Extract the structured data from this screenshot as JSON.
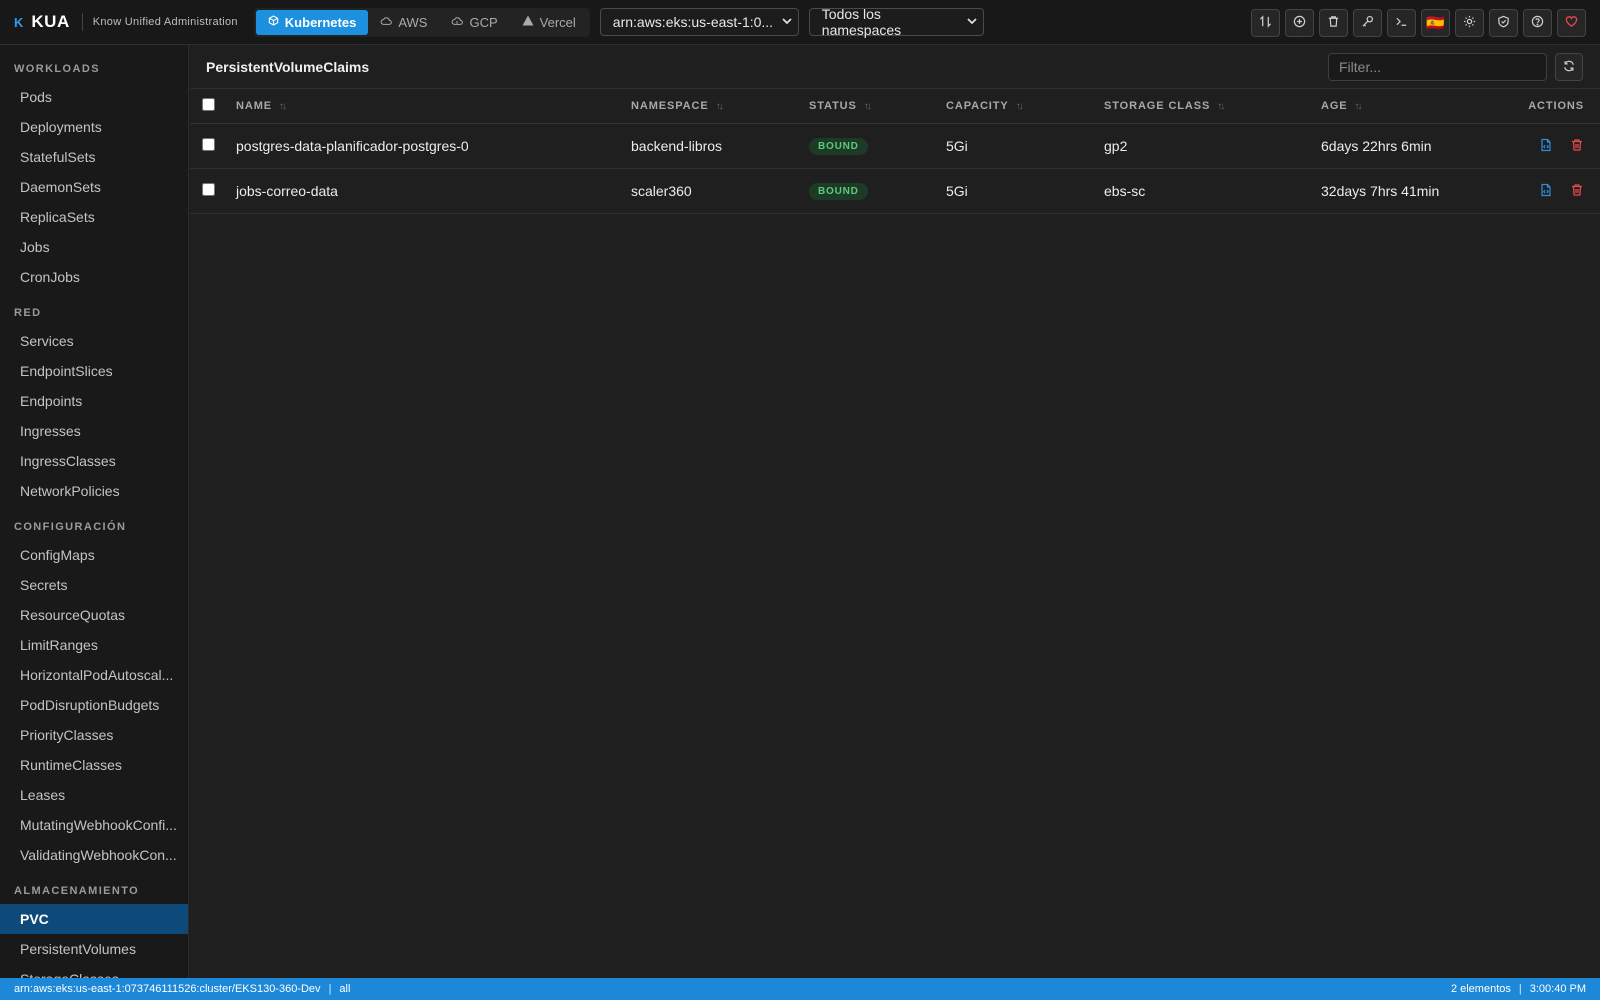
{
  "app": {
    "logo_mark": "K",
    "name": "KUA",
    "subtitle": "Know Unified Administration"
  },
  "providers": [
    {
      "label": "Kubernetes",
      "icon": "cube-icon",
      "active": true
    },
    {
      "label": "AWS",
      "icon": "cloud-icon",
      "active": false
    },
    {
      "label": "GCP",
      "icon": "cloud-icon",
      "active": false
    },
    {
      "label": "Vercel",
      "icon": "triangle-icon",
      "active": false
    }
  ],
  "cluster_select": {
    "value": "arn:aws:eks:us-east-1:0..."
  },
  "namespace_select": {
    "value": "Todos los namespaces"
  },
  "toolbar": {
    "icons": [
      "port-forward-icon",
      "add-circle-icon",
      "trash-icon",
      "key-icon",
      "terminal-icon",
      "spain-flag-icon",
      "sun-icon",
      "shield-icon",
      "help-icon",
      "heart-icon"
    ],
    "flag_glyph": "🇪🇸"
  },
  "sidebar": {
    "sections": [
      {
        "title": "WORKLOADS",
        "items": [
          "Pods",
          "Deployments",
          "StatefulSets",
          "DaemonSets",
          "ReplicaSets",
          "Jobs",
          "CronJobs"
        ]
      },
      {
        "title": "RED",
        "items": [
          "Services",
          "EndpointSlices",
          "Endpoints",
          "Ingresses",
          "IngressClasses",
          "NetworkPolicies"
        ]
      },
      {
        "title": "CONFIGURACIÓN",
        "items": [
          "ConfigMaps",
          "Secrets",
          "ResourceQuotas",
          "LimitRanges",
          "HorizontalPodAutoscal...",
          "PodDisruptionBudgets",
          "PriorityClasses",
          "RuntimeClasses",
          "Leases",
          "MutatingWebhookConfi...",
          "ValidatingWebhookCon..."
        ]
      },
      {
        "title": "ALMACENAMIENTO",
        "items": [
          "PVC",
          "PersistentVolumes",
          "StorageClasses"
        ]
      }
    ],
    "active_item": "PVC"
  },
  "main": {
    "title": "PersistentVolumeClaims",
    "filter_placeholder": "Filter...",
    "columns": {
      "name": "NAME",
      "namespace": "NAMESPACE",
      "status": "STATUS",
      "capacity": "CAPACITY",
      "storage_class": "STORAGE CLASS",
      "age": "AGE",
      "actions": "ACTIONS"
    },
    "rows": [
      {
        "name": "postgres-data-planificador-postgres-0",
        "namespace": "backend-libros",
        "status": "BOUND",
        "capacity": "5Gi",
        "storage_class": "gp2",
        "age": "6days 22hrs 6min"
      },
      {
        "name": "jobs-correo-data",
        "namespace": "scaler360",
        "status": "BOUND",
        "capacity": "5Gi",
        "storage_class": "ebs-sc",
        "age": "32days 7hrs 41min"
      }
    ]
  },
  "statusbar": {
    "cluster": "arn:aws:eks:us-east-1:073746111526:cluster/EKS130-360-Dev",
    "namespace": "all",
    "count": "2 elementos",
    "time": "3:00:40 PM"
  },
  "colors": {
    "accent": "#1e90e0",
    "statusbar": "#1e88d8",
    "active_nav": "#0d4a7a",
    "bound_badge_text": "#5bc97a",
    "delete_red": "#e5484d"
  }
}
